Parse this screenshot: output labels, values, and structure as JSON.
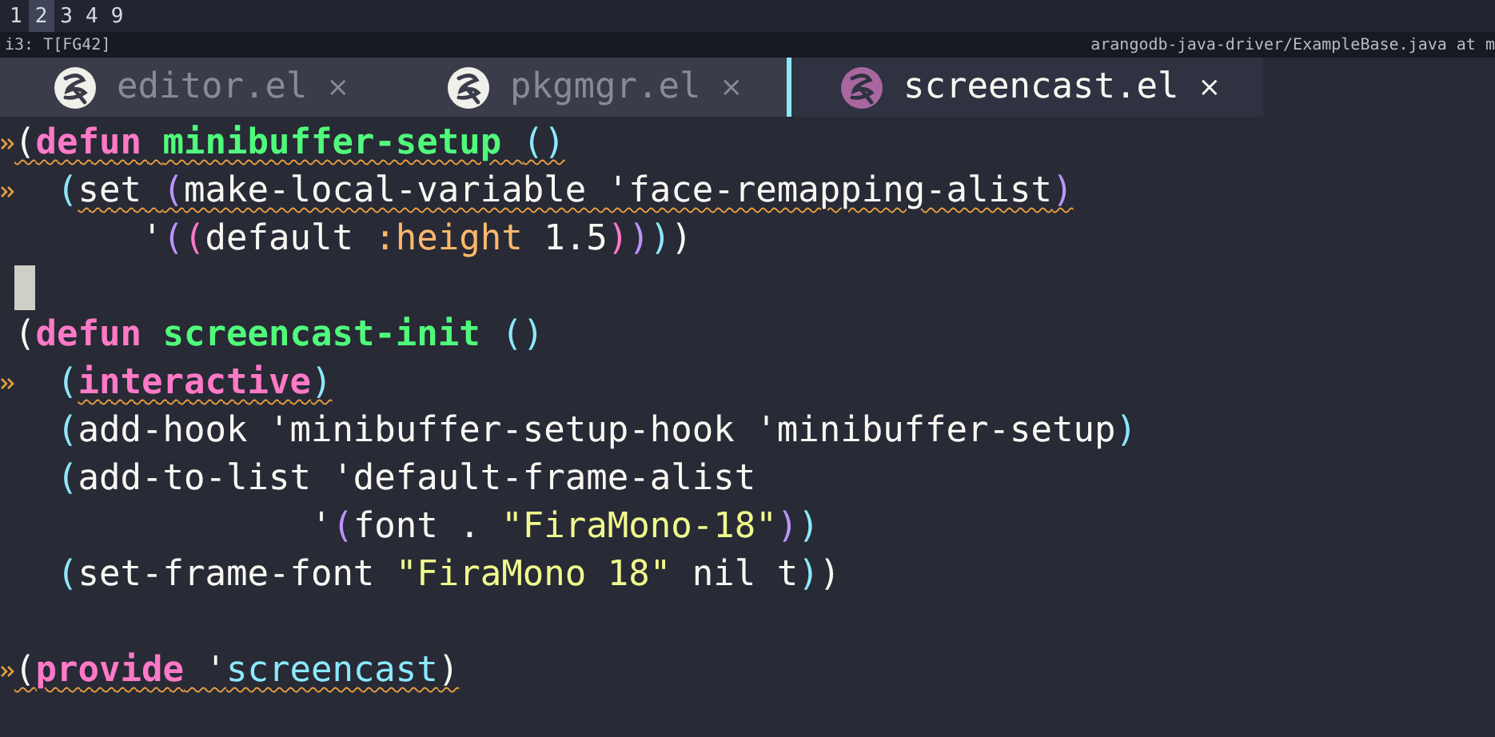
{
  "workspaces": [
    {
      "label": "1",
      "selected": false
    },
    {
      "label": "2",
      "selected": true
    },
    {
      "label": "3",
      "selected": false
    },
    {
      "label": "4",
      "selected": false
    },
    {
      "label": "9",
      "selected": false
    }
  ],
  "window_title": {
    "left": "i3: T[FG42]",
    "right": "arangodb-java-driver/ExampleBase.java at m"
  },
  "tabs": [
    {
      "label": "editor.el",
      "close": "×",
      "selected": false
    },
    {
      "label": "pkgmgr.el",
      "close": "×",
      "selected": false
    },
    {
      "label": "screencast.el",
      "close": "×",
      "selected": true
    }
  ],
  "lines": [
    {
      "fringe": true,
      "cursor": false,
      "tokens": [
        {
          "kind": "paren1",
          "text": "(",
          "warn": true
        },
        {
          "kind": "keyword",
          "text": "defun ",
          "warn": true
        },
        {
          "kind": "name",
          "text": "minibuffer-setup ",
          "warn": true
        },
        {
          "kind": "paren2",
          "text": "()",
          "warn": true
        }
      ]
    },
    {
      "fringe": true,
      "cursor": false,
      "tokens": [
        {
          "kind": "paren2",
          "text": "  (",
          "warn": false
        },
        {
          "kind": "text",
          "text": "set ",
          "warn": true
        },
        {
          "kind": "paren3",
          "text": "(",
          "warn": true
        },
        {
          "kind": "text",
          "text": "make-local-variable 'face-remapping-alist",
          "warn": true
        },
        {
          "kind": "paren3",
          "text": ")",
          "warn": true
        }
      ]
    },
    {
      "fringe": false,
      "cursor": false,
      "tokens": [
        {
          "kind": "text",
          "text": "      '",
          "warn": false
        },
        {
          "kind": "paren3",
          "text": "(",
          "warn": false
        },
        {
          "kind": "paren4",
          "text": "(",
          "warn": false
        },
        {
          "kind": "text",
          "text": "default ",
          "warn": false
        },
        {
          "kind": "key",
          "text": ":height",
          "warn": false
        },
        {
          "kind": "text",
          "text": " 1.5",
          "warn": false
        },
        {
          "kind": "paren4",
          "text": ")",
          "warn": false
        },
        {
          "kind": "paren3",
          "text": ")",
          "warn": false
        },
        {
          "kind": "paren2",
          "text": ")",
          "warn": false
        },
        {
          "kind": "paren1",
          "text": ")",
          "warn": false
        }
      ]
    },
    {
      "fringe": false,
      "cursor": true
    },
    {
      "fringe": false,
      "cursor": false,
      "tokens": [
        {
          "kind": "paren1",
          "text": "(",
          "warn": false
        },
        {
          "kind": "keyword",
          "text": "defun ",
          "warn": false
        },
        {
          "kind": "name",
          "text": "screencast-init ",
          "warn": false
        },
        {
          "kind": "paren2",
          "text": "()",
          "warn": false
        }
      ]
    },
    {
      "fringe": true,
      "cursor": false,
      "tokens": [
        {
          "kind": "paren2",
          "text": "  (",
          "warn": false
        },
        {
          "kind": "keyword",
          "text": "interactive",
          "warn": true
        },
        {
          "kind": "paren2",
          "text": ")",
          "warn": true
        }
      ]
    },
    {
      "fringe": false,
      "cursor": false,
      "tokens": [
        {
          "kind": "paren2",
          "text": "  (",
          "warn": false
        },
        {
          "kind": "text",
          "text": "add-hook 'minibuffer-setup-hook 'minibuffer-setup",
          "warn": false
        },
        {
          "kind": "paren2",
          "text": ")",
          "warn": false
        }
      ]
    },
    {
      "fringe": false,
      "cursor": false,
      "tokens": [
        {
          "kind": "paren2",
          "text": "  (",
          "warn": false
        },
        {
          "kind": "text",
          "text": "add-to-list 'default-frame-alist",
          "warn": false
        }
      ]
    },
    {
      "fringe": false,
      "cursor": false,
      "tokens": [
        {
          "kind": "text",
          "text": "              '",
          "warn": false
        },
        {
          "kind": "paren3",
          "text": "(",
          "warn": false
        },
        {
          "kind": "text",
          "text": "font . ",
          "warn": false
        },
        {
          "kind": "string",
          "text": "\"FiraMono-18\"",
          "warn": false
        },
        {
          "kind": "paren3",
          "text": ")",
          "warn": false
        },
        {
          "kind": "paren2",
          "text": ")",
          "warn": false
        }
      ]
    },
    {
      "fringe": false,
      "cursor": false,
      "tokens": [
        {
          "kind": "paren2",
          "text": "  (",
          "warn": false
        },
        {
          "kind": "text",
          "text": "set-frame-font ",
          "warn": false
        },
        {
          "kind": "string",
          "text": "\"FiraMono 18\"",
          "warn": false
        },
        {
          "kind": "text",
          "text": " nil t",
          "warn": false
        },
        {
          "kind": "paren2",
          "text": ")",
          "warn": false
        },
        {
          "kind": "paren1",
          "text": ")",
          "warn": false
        }
      ]
    },
    {
      "fringe": false,
      "cursor": false
    },
    {
      "fringe": true,
      "cursor": false,
      "tokens": [
        {
          "kind": "paren1",
          "text": "(",
          "warn": true
        },
        {
          "kind": "keyword",
          "text": "provide",
          "warn": true
        },
        {
          "kind": "text",
          "text": " '",
          "warn": true
        },
        {
          "kind": "symbol",
          "text": "screencast",
          "warn": true
        },
        {
          "kind": "paren1",
          "text": ")",
          "warn": true
        }
      ]
    }
  ]
}
